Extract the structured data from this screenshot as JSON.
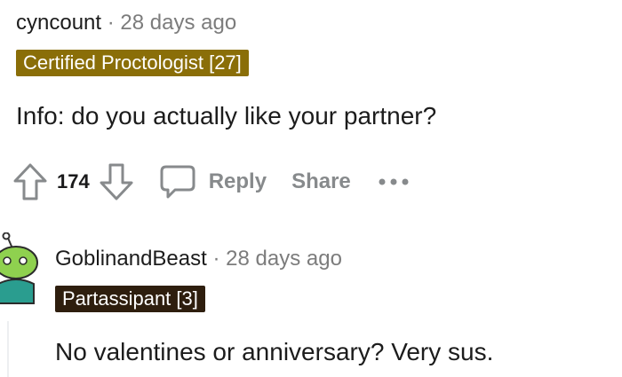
{
  "comments": [
    {
      "author": "cyncount",
      "separator": "·",
      "time": "28 days ago",
      "flair": "Certified Proctologist [27]",
      "flair_color": "#8a6e08",
      "body": "Info: do you actually like your partner?",
      "votes": "174",
      "actions": {
        "upvote_icon": "upvote-arrow-icon",
        "downvote_icon": "downvote-arrow-icon",
        "reply_icon": "speech-bubble-icon",
        "reply_label": "Reply",
        "share_label": "Share",
        "more_icon": "ellipsis-icon"
      }
    },
    {
      "author": "GoblinandBeast",
      "separator": "·",
      "time": "28 days ago",
      "flair": "Partassipant [3]",
      "flair_color": "#2e1e0e",
      "body": "No valentines or anniversary? Very sus.",
      "avatar_icon": "snoo-avatar-icon"
    }
  ],
  "colors": {
    "meta_gray": "#7c7c7c",
    "action_gray": "#878a8c",
    "text": "#1c1c1c"
  }
}
